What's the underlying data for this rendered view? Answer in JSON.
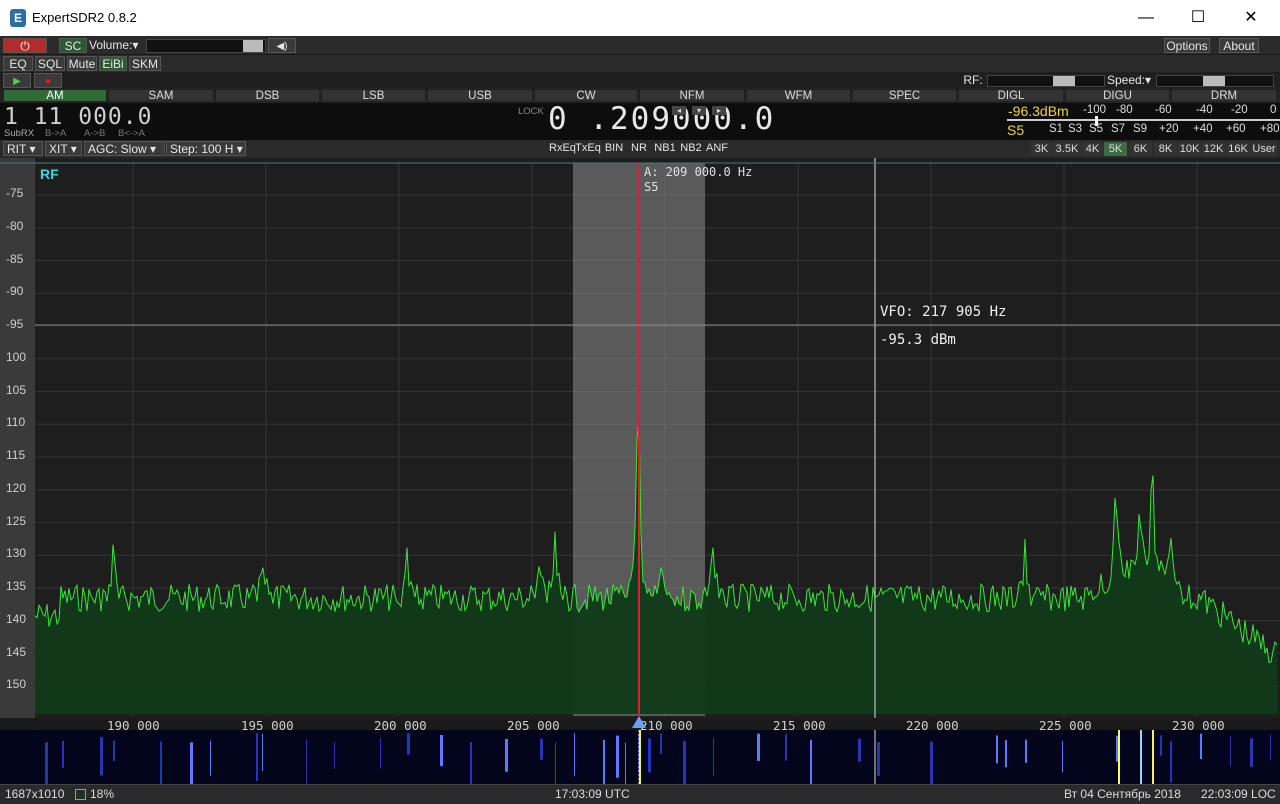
{
  "window": {
    "title": "ExpertSDR2 0.8.2",
    "minimize": "—",
    "maximize": "☐",
    "close": "✕"
  },
  "toolbar1": {
    "power": "⏻",
    "sc": "SC",
    "volume": "Volume:▾",
    "speaker": "◀)",
    "options": "Options",
    "about": "About"
  },
  "toolbar2": {
    "eq": "EQ",
    "sql": "SQL",
    "mute": "Mute",
    "eibi": "EiBi",
    "skm": "SKM"
  },
  "toolbar3": {
    "play": "▶",
    "rec": "●",
    "rf": "RF:",
    "speed": "Speed:▾"
  },
  "modes": [
    "AM",
    "SAM",
    "DSB",
    "LSB",
    "USB",
    "CW",
    "NFM",
    "WFM",
    "SPEC",
    "DIGL",
    "DIGU",
    "DRM"
  ],
  "freq": {
    "sub_display": "1 11 000.0",
    "subrx": "SubRX",
    "b_a": "B->A",
    "a_b": "A->B",
    "b_swap_a": "B<->A",
    "lock": "LOCK",
    "main_display": "0 .209000.0"
  },
  "meter": {
    "dbm": "-96.3dBm",
    "smeter": "S5",
    "top_scale": [
      "-100",
      "-80",
      "-60",
      "-40",
      "-20",
      "0"
    ],
    "bottom_scale": [
      "S1",
      "S3",
      "S5",
      "S7",
      "S9",
      "+20",
      "+40",
      "+60",
      "+80"
    ]
  },
  "controls": {
    "rit": "RIT ▾",
    "xit": "XIT ▾",
    "agc": "AGC: Slow ▾",
    "step": "Step: 100 H ▾",
    "dsp": [
      "RxEq",
      "TxEq",
      "BIN",
      "NR",
      "NB1",
      "NB2",
      "ANF"
    ],
    "bandwidths": [
      "3K",
      "3.5K",
      "4K",
      "5K",
      "6K",
      "8K",
      "10K",
      "12K",
      "16K",
      "User"
    ],
    "bw_active": "5K"
  },
  "spectrum": {
    "label": "RF",
    "marker_freq": "A: 209 000.0 Hz",
    "marker_s": "S5",
    "vfo": "VFO: 217 905 Hz",
    "vfo_dbm": "-95.3 dBm",
    "y_ticks": [
      "-75",
      "-80",
      "-85",
      "-90",
      "-95",
      "100",
      "105",
      "110",
      "115",
      "120",
      "125",
      "130",
      "135",
      "140",
      "145",
      "150"
    ],
    "x_ticks": [
      "190 000",
      "195 000",
      "200 000",
      "205 000",
      "210 000",
      "215 000",
      "220 000",
      "225 000",
      "230 000"
    ]
  },
  "status": {
    "resolution": "1687x1010",
    "cpu": "18%",
    "utc": "17:03:09 UTC",
    "date": "Вт 04 Сентябрь 2018",
    "local": "22:03:09 LOC"
  },
  "colors": {
    "accent_green": "#2f6b35",
    "trace": "#39e639",
    "fill": "#123a1a",
    "filter": "#8c8c8c",
    "center_line": "#e02020",
    "meter_yellow": "#f2d23a"
  }
}
